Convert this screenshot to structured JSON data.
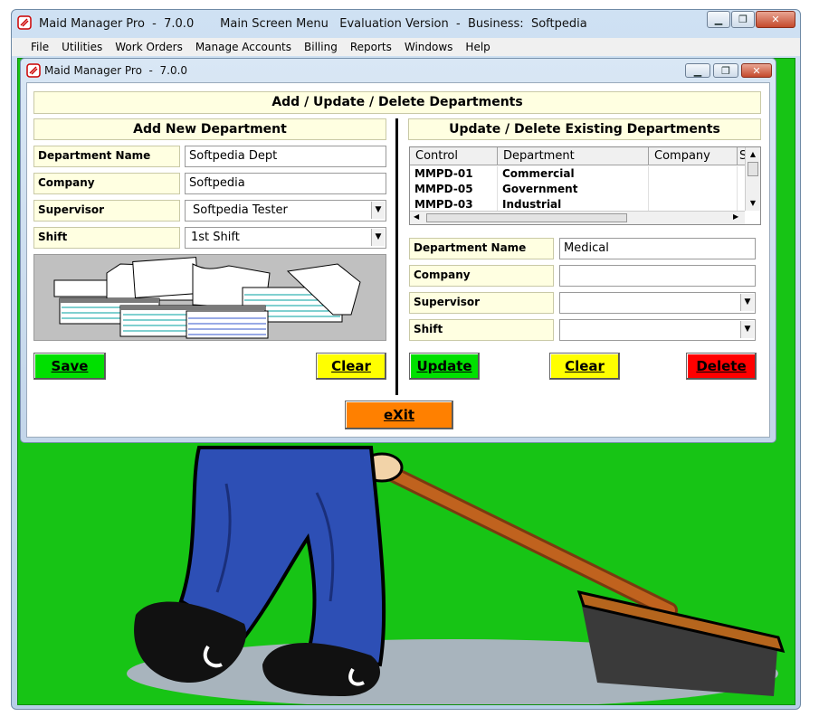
{
  "app": {
    "title": "Maid Manager Pro  -  7.0.0       Main Screen Menu   Evaluation Version  -  Business:  Softpedia"
  },
  "menu": [
    "File",
    "Utilities",
    "Work Orders",
    "Manage Accounts",
    "Billing",
    "Reports",
    "Windows",
    "Help"
  ],
  "dialog": {
    "title": "Maid Manager Pro  -  7.0.0",
    "header": "Add / Update / Delete Departments",
    "add": {
      "title": "Add New Department",
      "department_name_label": "Department Name",
      "department_name_value": "Softpedia Dept",
      "company_label": "Company",
      "company_value": "Softpedia",
      "supervisor_label": "Supervisor",
      "supervisor_value": "Softpedia Tester",
      "shift_label": "Shift",
      "shift_value": "1st Shift",
      "save_label": "Save",
      "clear_label": "Clear"
    },
    "update": {
      "title": "Update / Delete Existing Departments",
      "columns": [
        "Control",
        "Department",
        "Company",
        "S"
      ],
      "rows": [
        {
          "control": "MMPD-01",
          "department": "Commercial",
          "company": ""
        },
        {
          "control": "MMPD-05",
          "department": "Government",
          "company": ""
        },
        {
          "control": "MMPD-03",
          "department": "Industrial",
          "company": ""
        }
      ],
      "department_name_label": "Department Name",
      "department_name_value": "Medical",
      "company_label": "Company",
      "company_value": "",
      "supervisor_label": "Supervisor",
      "supervisor_value": "",
      "shift_label": "Shift",
      "shift_value": "",
      "update_label": "Update",
      "clear_label": "Clear",
      "delete_label": "Delete"
    },
    "exit_label": "eXit"
  },
  "colors": {
    "scene_green": "#17c415",
    "label_yellow": "#ffffe1",
    "save_green": "#00e000",
    "clear_yellow": "#ffff00",
    "delete_red": "#ff0000",
    "exit_orange": "#ff8000"
  }
}
